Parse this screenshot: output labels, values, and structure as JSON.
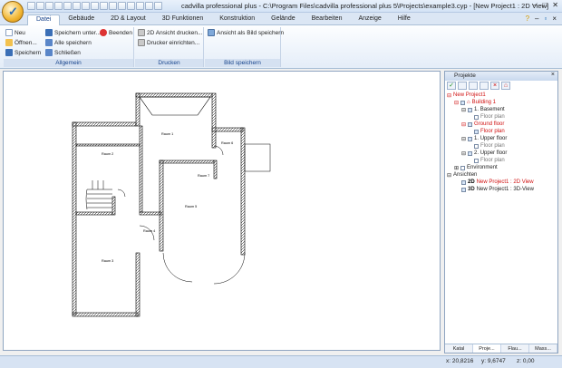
{
  "window": {
    "title": "cadvilla professional plus - C:\\Program Files\\cadvilla professional plus 5\\Projects\\example3.cyp - [New Project1 : 2D View]",
    "controls": [
      "–",
      "□",
      "✕"
    ]
  },
  "menu_tabs": [
    "Datei",
    "Gebäude",
    "2D & Layout",
    "3D Funktionen",
    "Konstruktion",
    "Gelände",
    "Bearbeiten",
    "Anzeige",
    "Hilfe"
  ],
  "active_tab": "Datei",
  "ribbon": {
    "allgemein": {
      "label": "Allgemein",
      "neu": "Neu",
      "oeffnen": "Öffnen...",
      "speichern": "Speichern",
      "speichern_unter": "Speichern unter...",
      "alle_speichern": "Alle speichern",
      "schliessen": "Schließen",
      "beenden": "Beenden"
    },
    "drucken": {
      "label": "Drucken",
      "ansicht_drucken": "2D Ansicht drucken...",
      "drucker_einrichten": "Drucker einrichten..."
    },
    "bild": {
      "label": "Bild speichern",
      "ansicht_als_bild": "Ansicht als Bild speichern"
    }
  },
  "floorplan": {
    "rooms": [
      "Raum 1",
      "Raum 2",
      "Raum 3",
      "Raum 4",
      "Raum 5",
      "Raum 6",
      "Raum 7"
    ]
  },
  "panel": {
    "title": "Projekte",
    "tree": {
      "project": "New Project1",
      "building": "Building 1",
      "basement": "1. Basement",
      "floor_plan_1": "Floor plan",
      "ground_floor": "Ground floor",
      "floor_plan_2": "Floor plan",
      "upper_floor_1": "1. Upper floor",
      "floor_plan_3": "Floor plan",
      "upper_floor_2": "2. Upper floor",
      "floor_plan_4": "Floor plan",
      "environment": "Environment",
      "ansichten": "Ansichten",
      "view_2d": "New Project1 : 2D View",
      "view_3d": "New Project1 : 3D-View",
      "label_2d": "2D",
      "label_3d": "3D"
    },
    "tabs": [
      "Katal",
      "Proje...",
      "Flau...",
      "Mass..."
    ]
  },
  "status": {
    "x": "x: 20,8216",
    "y": "y: 9,6747",
    "z": "z: 0,00"
  },
  "colors": {
    "accent": "#15428b",
    "highlight_red": "#d01010",
    "wall_hatch": "#000000"
  }
}
